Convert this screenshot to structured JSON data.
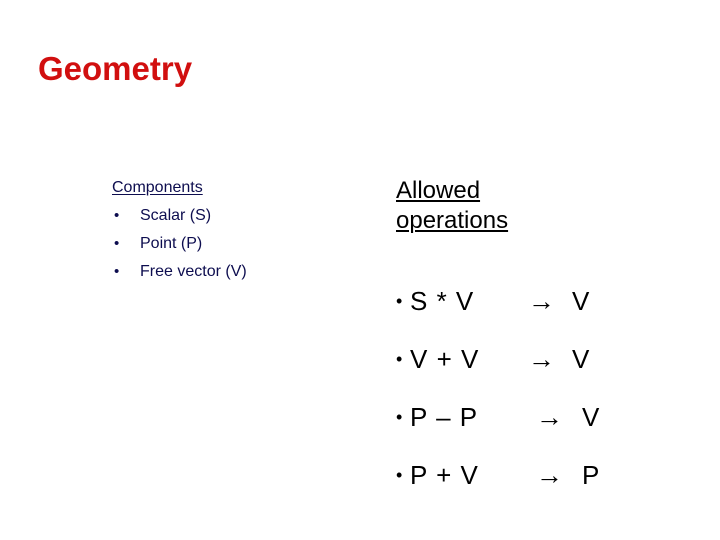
{
  "slide": {
    "title": "Geometry",
    "title_color": "#d10f0f",
    "background_color": "#ffffff"
  },
  "components": {
    "heading": "Components",
    "text_color": "#0d0d4f",
    "bullet_glyph": "•",
    "items": [
      {
        "label": "Scalar (S)"
      },
      {
        "label": "Point (P)"
      },
      {
        "label": "Free vector (V)"
      }
    ]
  },
  "operations": {
    "heading_line1": "Allowed",
    "heading_line2": "operations",
    "text_color": "#000000",
    "bullet_glyph": "•",
    "arrow_glyph": "→",
    "items": [
      {
        "expression": "S * V",
        "arrow": "→",
        "result": "V"
      },
      {
        "expression": "V + V",
        "arrow": "→",
        "result": "V"
      },
      {
        "expression": "P – P",
        "arrow": "→",
        "result": "V"
      },
      {
        "expression": "P + V",
        "arrow": "→",
        "result": "P"
      }
    ]
  }
}
